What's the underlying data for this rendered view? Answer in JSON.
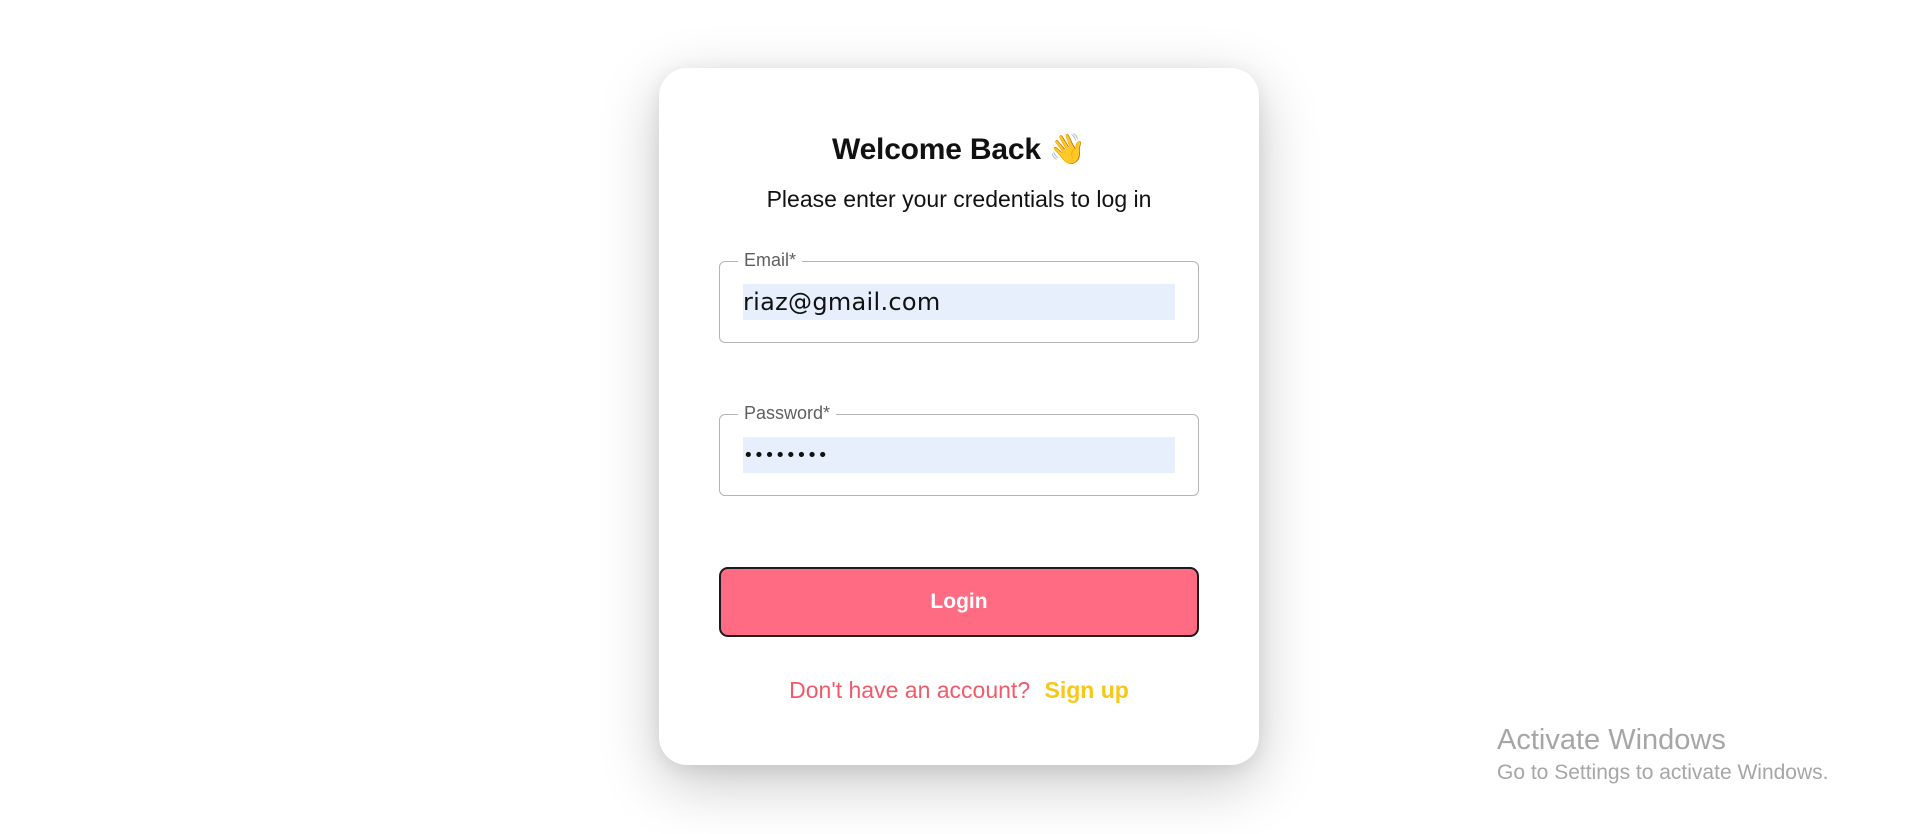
{
  "login": {
    "title": "Welcome Back",
    "title_emoji": "👋",
    "subtitle": "Please enter your credentials to log in",
    "email": {
      "label": "Email*",
      "value": "riaz@gmail.com"
    },
    "password": {
      "label": "Password*",
      "value": "••••••••"
    },
    "submit_label": "Login",
    "signup_prompt": "Don't have an account?",
    "signup_link": "Sign up"
  },
  "watermark": {
    "title": "Activate Windows",
    "subtitle": "Go to Settings to activate Windows."
  },
  "colors": {
    "button": "#ff6b82",
    "signup_prompt": "#f25a6a",
    "signup_link": "#f7c816",
    "input_fill": "#e8effc"
  },
  "icons": {
    "title_emoji": "waving-hand-icon"
  }
}
